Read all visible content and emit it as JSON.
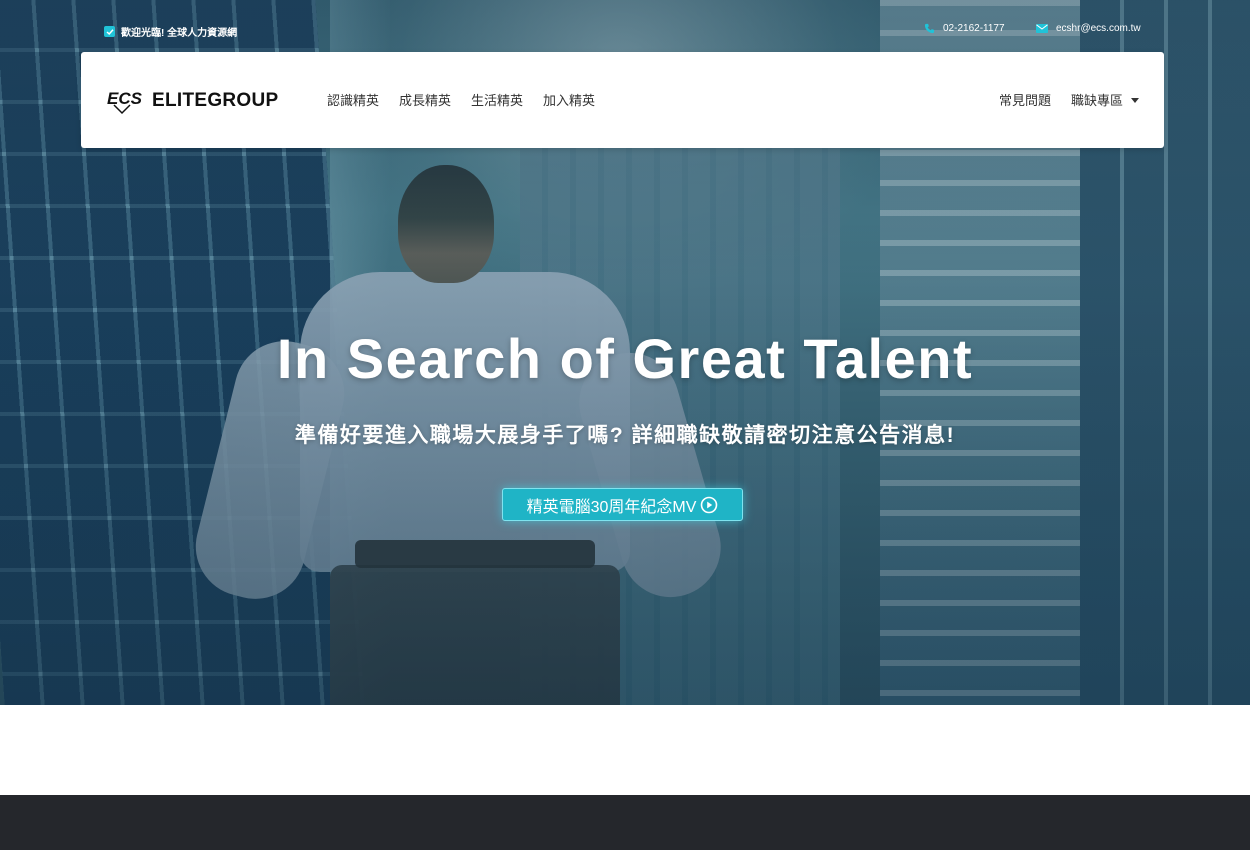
{
  "topbar": {
    "welcome_text": "歡迎光臨! 全球人力資源網",
    "phone": "02-2162-1177",
    "email": "ecshr@ecs.com.tw"
  },
  "nav": {
    "logo_mark": "ECS",
    "logo_text": "ELITEGROUP",
    "left_items": [
      "認識精英",
      "成長精英",
      "生活精英",
      "加入精英"
    ],
    "faq_label": "常見問題",
    "jobs_label": "職缺專區"
  },
  "hero": {
    "title": "In Search of Great Talent",
    "subtitle": "準備好要進入職場大展身手了嗎? 詳細職缺敬請密切注意公告消息!",
    "button_label": "精英電腦30周年紀念MV"
  },
  "colors": {
    "accent": "#20c3d8",
    "button_bg": "#1fb4c6",
    "footer_bg": "#25272c"
  },
  "icons": {
    "welcome": "checkbox-icon",
    "phone": "phone-icon",
    "email": "envelope-icon",
    "play": "play-circle-icon",
    "dropdown": "caret-down-icon"
  }
}
